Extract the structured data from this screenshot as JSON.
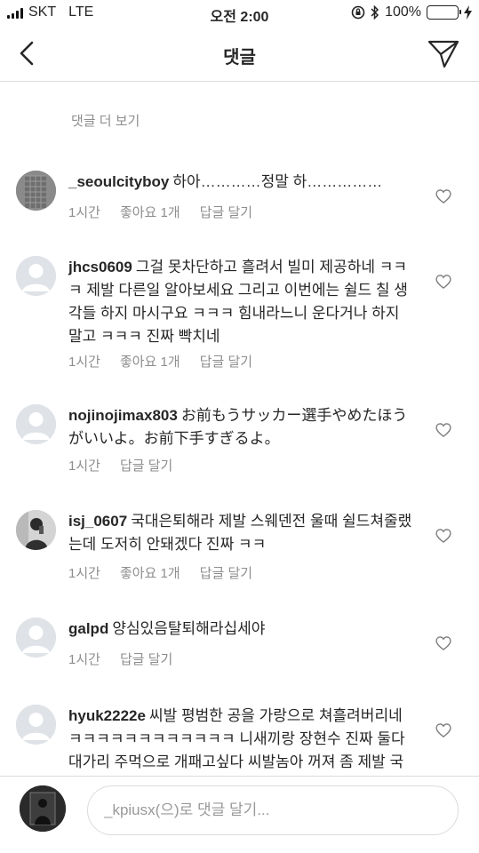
{
  "status_bar": {
    "carrier": "SKT",
    "network": "LTE",
    "time": "오전 2:00",
    "battery": "100%",
    "battery_level": 1.0,
    "battery_color": "#4cd964"
  },
  "nav": {
    "title": "댓글",
    "back_icon": "chevron-left-icon",
    "send_icon": "paper-plane-icon"
  },
  "load_more": "댓글 더 보기",
  "comments": [
    {
      "username": "_seoulcityboy",
      "text": "하아…………정말 하……………",
      "time": "1시간",
      "likes": "좋아요 1개",
      "reply": "답글 달기"
    },
    {
      "username": "jhcs0609",
      "text": "그걸 못차단하고 흘려서 빌미 제공하네 ㅋㅋㅋ 제발 다른일 알아보세요 그리고 이번에는 쉴드 칠 생각들 하지 마시구요 ㅋㅋㅋ 힘내라느니 운다거나 하지 말고 ㅋㅋㅋ 진짜 빡치네",
      "time": "1시간",
      "likes": "좋아요 1개",
      "reply": "답글 달기"
    },
    {
      "username": "nojinojimax803",
      "text": "お前もうサッカー選手やめたほうがいいよ。お前下手すぎるよ。",
      "time": "1시간",
      "reply": "답글 달기"
    },
    {
      "username": "isj_0607",
      "text": "국대은퇴해라 제발 스웨덴전 울때 쉴드쳐줄랬는데 도저히 안돼겠다 진짜 ㅋㅋ",
      "time": "1시간",
      "likes": "좋아요 1개",
      "reply": "답글 달기"
    },
    {
      "username": "galpd",
      "text": "양심있음탈퇴해라십세야",
      "time": "1시간",
      "reply": "답글 달기"
    },
    {
      "username": "hyuk2222e",
      "text": "씨발 평범한 공을 가랑으로 쳐흘려버리네 ㅋㅋㅋㅋㅋㅋㅋㅋㅋㅋㅋㅋ 니새끼랑 장현수 진짜 둘다 대가리 주먹으로 개패고싶다 씨발놈아 꺼져 좀 제발 국대에서"
    }
  ],
  "input": {
    "placeholder": "_kpiusx(으)로 댓글 달기..."
  }
}
